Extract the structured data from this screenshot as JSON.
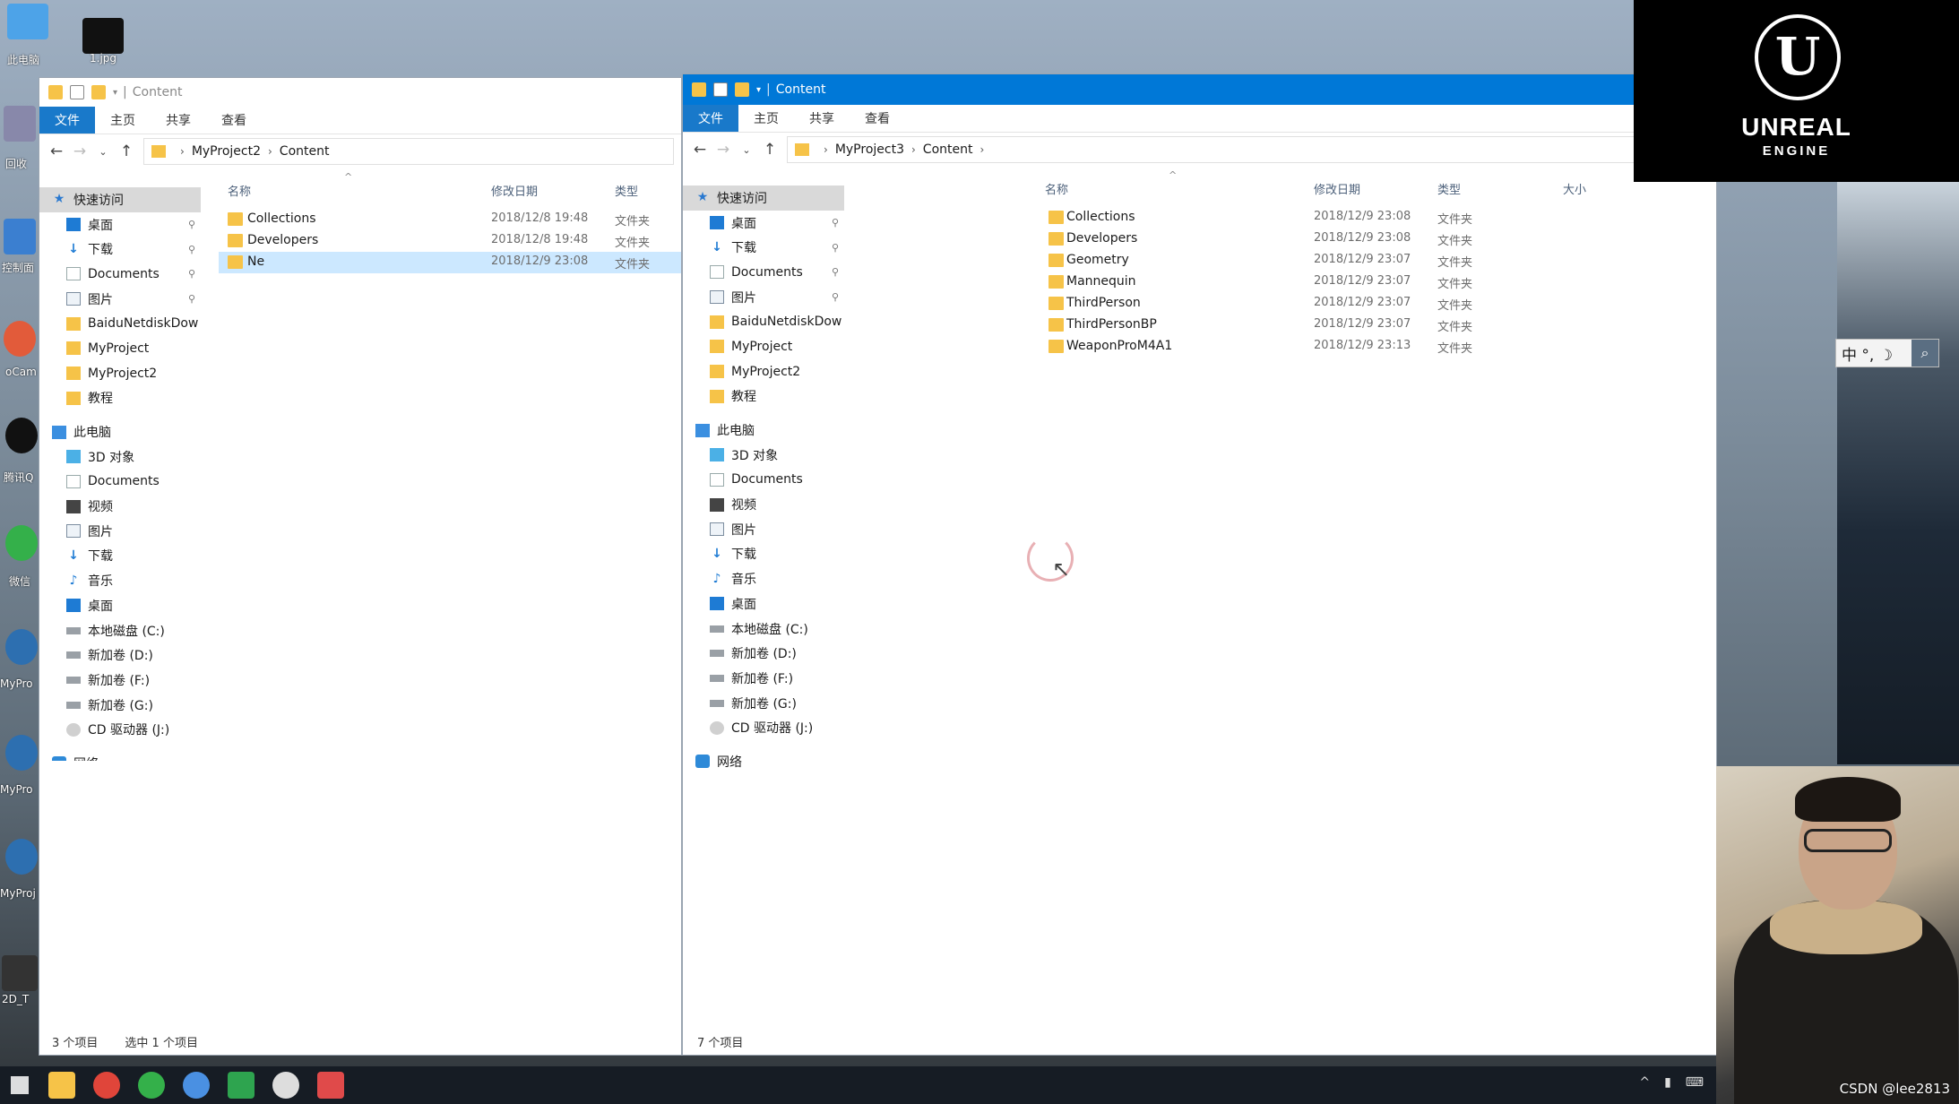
{
  "desktop": {
    "icons": [
      {
        "label": "此电脑"
      },
      {
        "label": "1.jpg"
      },
      {
        "label": "回收"
      },
      {
        "label": "控制面"
      },
      {
        "label": "oCam"
      },
      {
        "label": "腾讯Q"
      },
      {
        "label": "微信"
      },
      {
        "label": "MyPro"
      },
      {
        "label": "MyPro"
      },
      {
        "label": "MyProj"
      },
      {
        "label": "2D_T"
      }
    ],
    "ue_logo": {
      "title": "UNREAL",
      "subtitle": "ENGINE"
    },
    "ime": {
      "text": "中 °, ☽"
    },
    "watermark": "CSDN @lee2813"
  },
  "left_window": {
    "title": "Content",
    "ribbon_tabs": [
      "文件",
      "主页",
      "共享",
      "查看"
    ],
    "address": [
      "MyProject2",
      "Content"
    ],
    "nav": [
      {
        "label": "快速访问",
        "icon": "star-icon",
        "pinned": false,
        "selected": true
      },
      {
        "label": "桌面",
        "icon": "desktop-icon",
        "pinned": true
      },
      {
        "label": "下载",
        "icon": "download-icon",
        "pinned": true
      },
      {
        "label": "Documents",
        "icon": "document-icon",
        "pinned": true
      },
      {
        "label": "图片",
        "icon": "picture-icon",
        "pinned": true
      },
      {
        "label": "BaiduNetdiskDow",
        "icon": "folder-icon",
        "pinned": false
      },
      {
        "label": "MyProject",
        "icon": "folder-icon",
        "pinned": false
      },
      {
        "label": "MyProject2",
        "icon": "folder-icon",
        "pinned": false
      },
      {
        "label": "教程",
        "icon": "folder-icon",
        "pinned": false
      },
      {
        "label": "此电脑",
        "icon": "pc-icon",
        "pinned": false,
        "group": true
      },
      {
        "label": "3D 对象",
        "icon": "3d-objects-icon",
        "pinned": false
      },
      {
        "label": "Documents",
        "icon": "document-icon",
        "pinned": false
      },
      {
        "label": "视频",
        "icon": "video-icon",
        "pinned": false
      },
      {
        "label": "图片",
        "icon": "picture-icon",
        "pinned": false
      },
      {
        "label": "下载",
        "icon": "download-icon",
        "pinned": false
      },
      {
        "label": "音乐",
        "icon": "music-icon",
        "pinned": false
      },
      {
        "label": "桌面",
        "icon": "desktop-icon",
        "pinned": false
      },
      {
        "label": "本地磁盘 (C:)",
        "icon": "drive-icon",
        "pinned": false
      },
      {
        "label": "新加卷 (D:)",
        "icon": "drive-icon",
        "pinned": false
      },
      {
        "label": "新加卷 (F:)",
        "icon": "drive-icon",
        "pinned": false
      },
      {
        "label": "新加卷 (G:)",
        "icon": "drive-icon",
        "pinned": false
      },
      {
        "label": "CD 驱动器 (J:)",
        "icon": "cd-drive-icon",
        "pinned": false
      },
      {
        "label": "网络",
        "icon": "network-icon",
        "pinned": false,
        "group": true
      }
    ],
    "columns": [
      "名称",
      "修改日期",
      "类型"
    ],
    "files": [
      {
        "name": "Collections",
        "date": "2018/12/8 19:48",
        "type": "文件夹"
      },
      {
        "name": "Developers",
        "date": "2018/12/8 19:48",
        "type": "文件夹"
      },
      {
        "name": "Ne",
        "date": "2018/12/9 23:08",
        "type": "文件夹",
        "selected": true
      }
    ],
    "status": {
      "count": "3 个项目",
      "selected": "选中 1 个项目"
    }
  },
  "right_window": {
    "title": "Content",
    "ribbon_tabs": [
      "文件",
      "主页",
      "共享",
      "查看"
    ],
    "address": [
      "MyProject3",
      "Content"
    ],
    "nav": [
      {
        "label": "快速访问",
        "icon": "star-icon",
        "pinned": false,
        "selected": true
      },
      {
        "label": "桌面",
        "icon": "desktop-icon",
        "pinned": true
      },
      {
        "label": "下载",
        "icon": "download-icon",
        "pinned": true
      },
      {
        "label": "Documents",
        "icon": "document-icon",
        "pinned": true
      },
      {
        "label": "图片",
        "icon": "picture-icon",
        "pinned": true
      },
      {
        "label": "BaiduNetdiskDow",
        "icon": "folder-icon",
        "pinned": false
      },
      {
        "label": "MyProject",
        "icon": "folder-icon",
        "pinned": false
      },
      {
        "label": "MyProject2",
        "icon": "folder-icon",
        "pinned": false
      },
      {
        "label": "教程",
        "icon": "folder-icon",
        "pinned": false
      },
      {
        "label": "此电脑",
        "icon": "pc-icon",
        "pinned": false,
        "group": true
      },
      {
        "label": "3D 对象",
        "icon": "3d-objects-icon",
        "pinned": false
      },
      {
        "label": "Documents",
        "icon": "document-icon",
        "pinned": false
      },
      {
        "label": "视频",
        "icon": "video-icon",
        "pinned": false
      },
      {
        "label": "图片",
        "icon": "picture-icon",
        "pinned": false
      },
      {
        "label": "下载",
        "icon": "download-icon",
        "pinned": false
      },
      {
        "label": "音乐",
        "icon": "music-icon",
        "pinned": false
      },
      {
        "label": "桌面",
        "icon": "desktop-icon",
        "pinned": false
      },
      {
        "label": "本地磁盘 (C:)",
        "icon": "drive-icon",
        "pinned": false
      },
      {
        "label": "新加卷 (D:)",
        "icon": "drive-icon",
        "pinned": false
      },
      {
        "label": "新加卷 (F:)",
        "icon": "drive-icon",
        "pinned": false
      },
      {
        "label": "新加卷 (G:)",
        "icon": "drive-icon",
        "pinned": false
      },
      {
        "label": "CD 驱动器 (J:)",
        "icon": "cd-drive-icon",
        "pinned": false
      },
      {
        "label": "网络",
        "icon": "network-icon",
        "pinned": false,
        "group": true
      }
    ],
    "columns": [
      "名称",
      "修改日期",
      "类型",
      "大小"
    ],
    "files": [
      {
        "name": "Collections",
        "date": "2018/12/9 23:08",
        "type": "文件夹"
      },
      {
        "name": "Developers",
        "date": "2018/12/9 23:08",
        "type": "文件夹"
      },
      {
        "name": "Geometry",
        "date": "2018/12/9 23:07",
        "type": "文件夹"
      },
      {
        "name": "Mannequin",
        "date": "2018/12/9 23:07",
        "type": "文件夹"
      },
      {
        "name": "ThirdPerson",
        "date": "2018/12/9 23:07",
        "type": "文件夹"
      },
      {
        "name": "ThirdPersonBP",
        "date": "2018/12/9 23:07",
        "type": "文件夹"
      },
      {
        "name": "WeaponProM4A1",
        "date": "2018/12/9 23:13",
        "type": "文件夹"
      }
    ],
    "status": {
      "count": "7 个项目"
    }
  },
  "taskbar": {
    "tray_text": "^"
  },
  "colors": {
    "accent": "#1979ca",
    "title_active": "#0078d7",
    "folder": "#f6c348",
    "selection": "#cce8ff"
  }
}
